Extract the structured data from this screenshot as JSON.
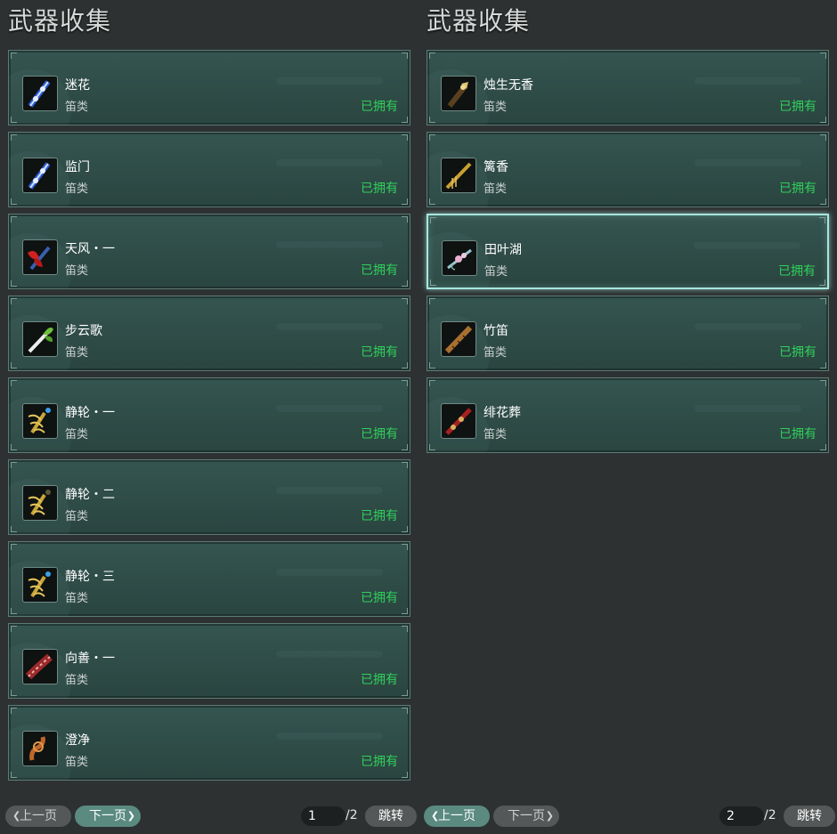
{
  "left_panel": {
    "title": "武器收集",
    "items": [
      {
        "name": "迷花",
        "type": "笛类",
        "status": "已拥有",
        "icon": "flute-blue-icon"
      },
      {
        "name": "监门",
        "type": "笛类",
        "status": "已拥有",
        "icon": "flute-blue-icon"
      },
      {
        "name": "天风・一",
        "type": "笛类",
        "status": "已拥有",
        "icon": "flute-red-feather-icon"
      },
      {
        "name": "步云歌",
        "type": "笛类",
        "status": "已拥有",
        "icon": "flute-white-leaf-icon"
      },
      {
        "name": "静轮・一",
        "type": "笛类",
        "status": "已拥有",
        "icon": "flute-gold-claw-icon"
      },
      {
        "name": "静轮・二",
        "type": "笛类",
        "status": "已拥有",
        "icon": "flute-gold-claw-icon"
      },
      {
        "name": "静轮・三",
        "type": "笛类",
        "status": "已拥有",
        "icon": "flute-gold-claw-icon"
      },
      {
        "name": "向善・一",
        "type": "笛类",
        "status": "已拥有",
        "icon": "flute-crimson-icon"
      },
      {
        "name": "澄净",
        "type": "笛类",
        "status": "已拥有",
        "icon": "flute-bronze-icon"
      }
    ],
    "pager": {
      "prev": "上一页",
      "next": "下一页",
      "current": "1",
      "total": "/2",
      "jump": "跳转",
      "prev_enabled": false,
      "next_enabled": true
    }
  },
  "right_panel": {
    "title": "武器收集",
    "items": [
      {
        "name": "烛生无香",
        "type": "笛类",
        "status": "已拥有",
        "icon": "flute-dark-gold-icon"
      },
      {
        "name": "篱香",
        "type": "笛类",
        "status": "已拥有",
        "icon": "flute-golden-icon"
      },
      {
        "name": "田叶湖",
        "type": "笛类",
        "status": "已拥有",
        "icon": "flute-flower-icon",
        "selected": true
      },
      {
        "name": "竹笛",
        "type": "笛类",
        "status": "已拥有",
        "icon": "flute-bamboo-icon"
      },
      {
        "name": "绯花葬",
        "type": "笛类",
        "status": "已拥有",
        "icon": "flute-red-icon"
      }
    ],
    "pager": {
      "prev": "上一页",
      "next": "下一页",
      "current": "2",
      "total": "/2",
      "jump": "跳转",
      "prev_enabled": true,
      "next_enabled": false
    }
  },
  "colors": {
    "owned_status": "#2fd05a",
    "card_bg": "#2f4c47",
    "selected_border": "#a7e6dd",
    "page_bg": "#2d3131"
  }
}
